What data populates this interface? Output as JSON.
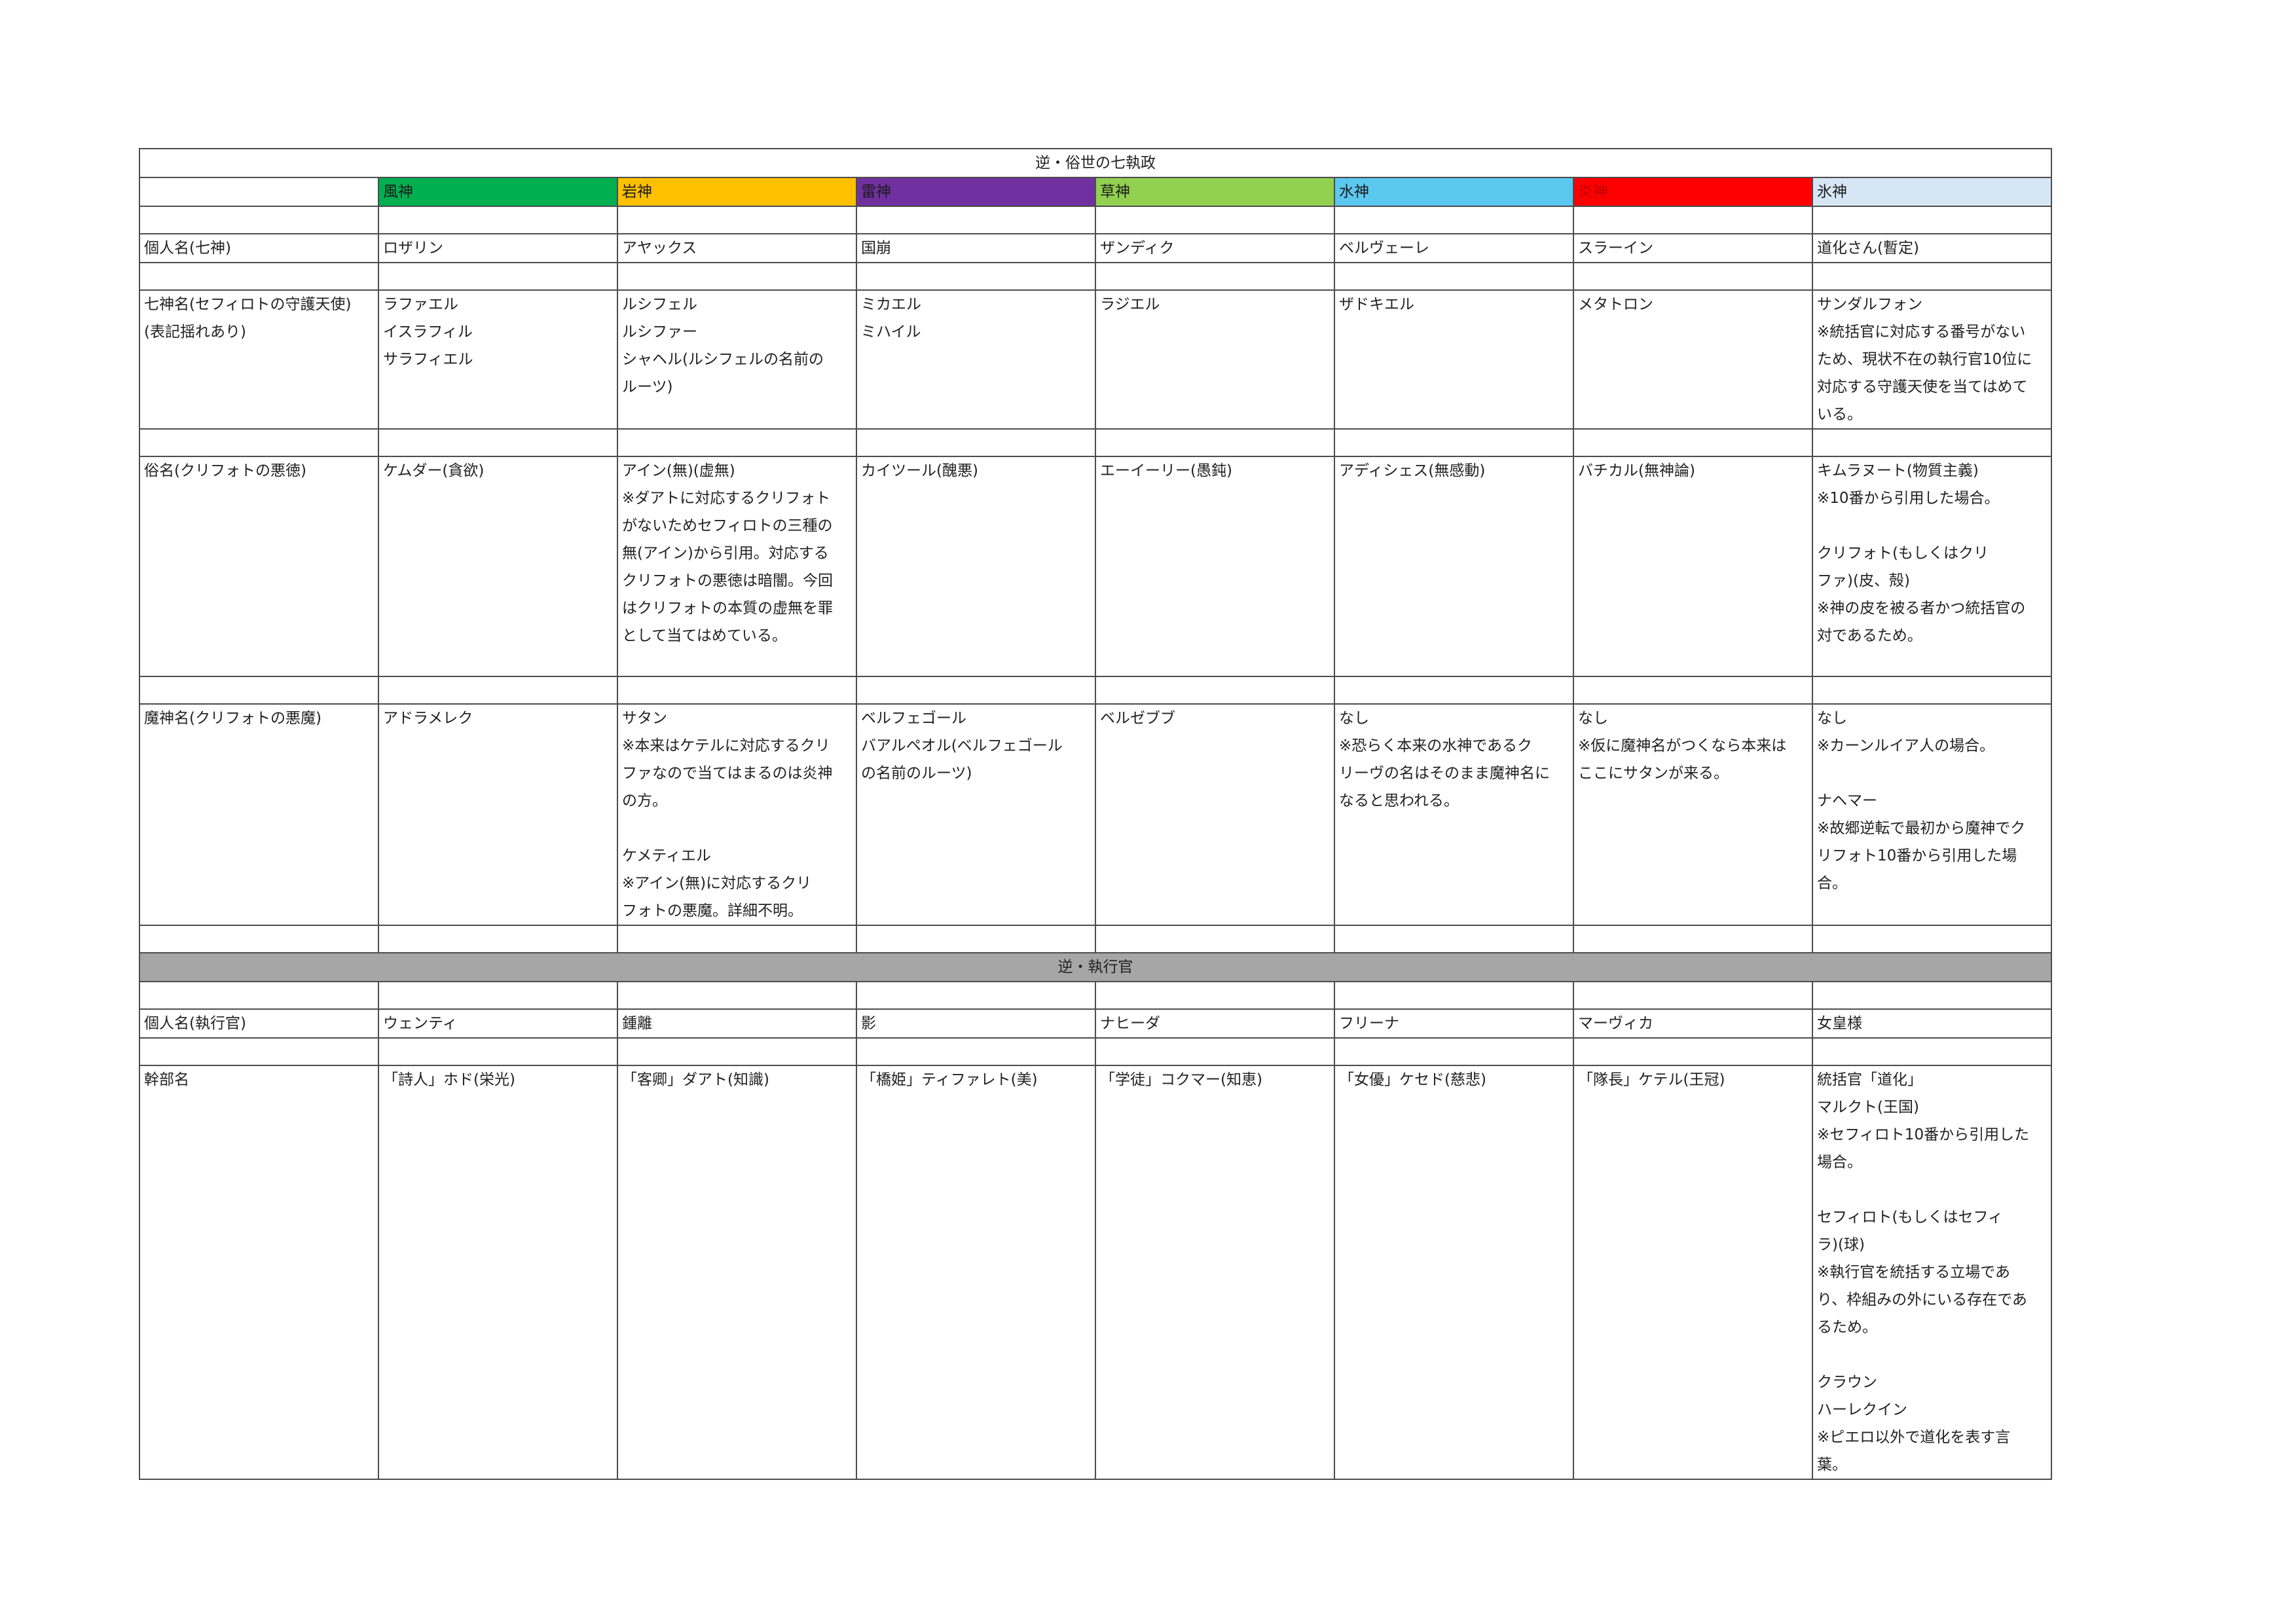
{
  "title1": "逆・俗世の七執政",
  "title2": "逆・執行官",
  "gods": [
    {
      "name": "風神",
      "color": "#00b050",
      "text_color": "#1b1b1b"
    },
    {
      "name": "岩神",
      "color": "#ffc000",
      "text_color": "#1b1b1b"
    },
    {
      "name": "雷神",
      "color": "#7030a0",
      "text_color": "#1b1b1b"
    },
    {
      "name": "草神",
      "color": "#92d050",
      "text_color": "#1b1b1b"
    },
    {
      "name": "水神",
      "color": "#5bc8ef",
      "text_color": "#1b1b1b"
    },
    {
      "name": "炎神",
      "color": "#ff0000",
      "text_color": "#c00000"
    },
    {
      "name": "氷神",
      "color": "#d6e6f5",
      "text_color": "#1b1b1b"
    }
  ],
  "rows": [
    {
      "label": "個人名(七神)",
      "cells": [
        "ロザリン",
        "アヤックス",
        "国崩",
        "ザンディク",
        "ベルヴェーレ",
        "スラーイン",
        "道化さん(暫定)"
      ]
    },
    {
      "label": "七神名(セフィロトの守護天使)\n(表記揺れあり)",
      "cells": [
        "ラファエル\nイスラフィル\nサラフィエル",
        "ルシフェル\nルシファー\nシャヘル(ルシフェルの名前の\nルーツ)",
        "ミカエル\nミハイル",
        "ラジエル",
        "ザドキエル",
        "メタトロン",
        "サンダルフォン\n※統括官に対応する番号がない\nため、現状不在の執行官10位に\n対応する守護天使を当てはめて\nいる。"
      ]
    },
    {
      "label": "俗名(クリフォトの悪徳)",
      "cells": [
        "ケムダー(貪欲)",
        "アイン(無)(虚無)\n※ダアトに対応するクリフォト\nがないためセフィロトの三種の\n無(アイン)から引用。対応する\nクリフォトの悪徳は暗闇。今回\nはクリフォトの本質の虚無を罪\nとして当てはめている。",
        "カイツール(醜悪)",
        "エーイーリー(愚鈍)",
        "アディシェス(無感動)",
        "バチカル(無神論)",
        "キムラヌート(物質主義)\n※10番から引用した場合。\n\nクリフォト(もしくはクリ\nファ)(皮、殻)\n※神の皮を被る者かつ統括官の\n対であるため。"
      ]
    },
    {
      "label": "魔神名(クリフォトの悪魔)",
      "cells": [
        "アドラメレク",
        "サタン\n※本来はケテルに対応するクリ\nファなので当てはまるのは炎神\nの方。\n\nケメティエル\n※アイン(無)に対応するクリ\nフォトの悪魔。詳細不明。",
        "ベルフェゴール\nバアルペオル(ベルフェゴール\nの名前のルーツ)",
        "ベルゼブブ",
        "なし\n※恐らく本来の水神であるク\nリーヴの名はそのまま魔神名に\nなると思われる。",
        "なし\n※仮に魔神名がつくなら本来は\nここにサタンが来る。",
        "なし\n※カーンルイア人の場合。\n\nナヘマー\n※故郷逆転で最初から魔神でク\nリフォト10番から引用した場\n合。"
      ]
    },
    {
      "label": "個人名(執行官)",
      "cells": [
        "ウェンティ",
        "鍾離",
        "影",
        "ナヒーダ",
        "フリーナ",
        "マーヴィカ",
        "女皇様"
      ]
    },
    {
      "label": "幹部名",
      "cells": [
        "「詩人」ホド(栄光)",
        "「客卿」ダアト(知識)",
        "「橋姫」ティファレト(美)",
        "「学徒」コクマー(知恵)",
        "「女優」ケセド(慈悲)",
        "「隊長」ケテル(王冠)",
        "統括官「道化」\nマルクト(王国)\n※セフィロト10番から引用した\n場合。\n\nセフィロト(もしくはセフィ\nラ)(球)\n※執行官を統括する立場であ\nり、枠組みの外にいる存在であ\nるため。\n\nクラウン\nハーレクイン\n※ピエロ以外で道化を表す言\n葉。"
      ]
    }
  ]
}
